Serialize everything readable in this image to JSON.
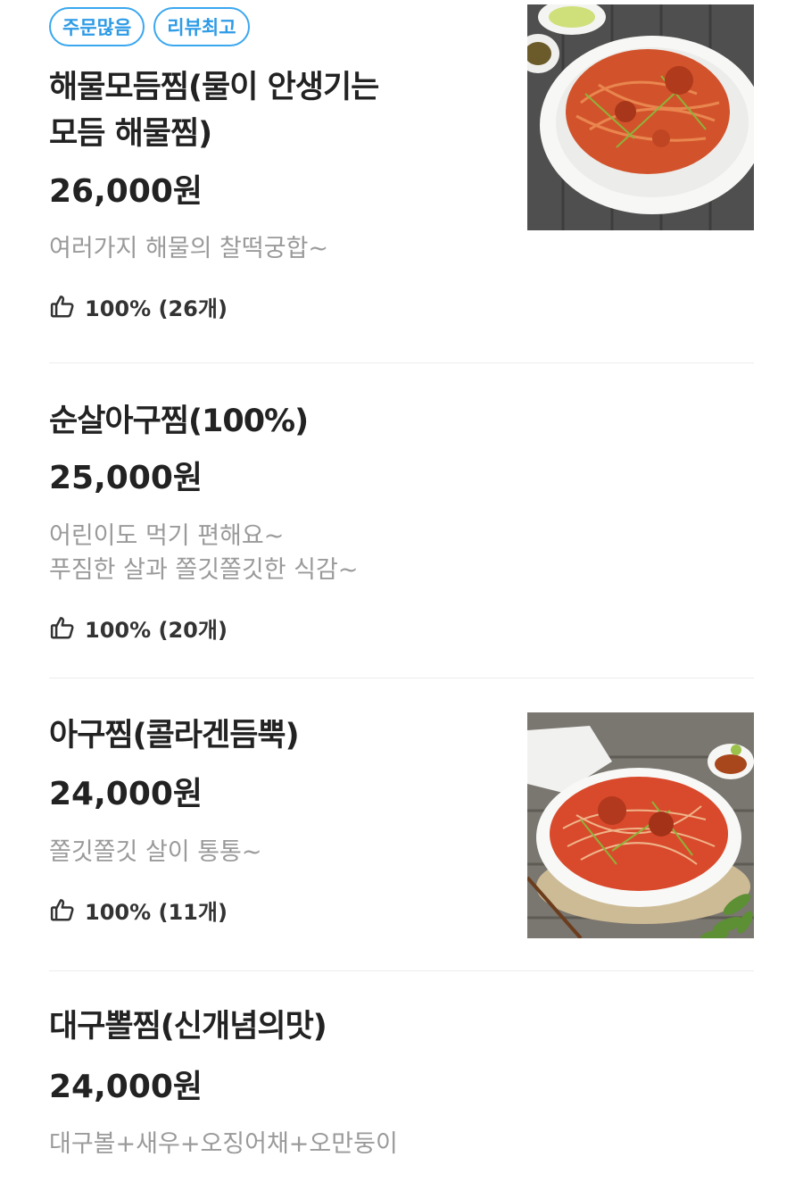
{
  "menu": {
    "items": [
      {
        "tags": [
          "주문많음",
          "리뷰최고"
        ],
        "name_line1": "해물모듬찜(물이 안생기는",
        "name_line2": "모듬 해물찜)",
        "price": "26,000원",
        "desc_line1": "여러가지 해물의 찰떡궁합~",
        "rating_text": "100% (26개)"
      },
      {
        "name_line1": "순살아구찜(100%)",
        "price": "25,000원",
        "desc_line1": "어린이도 먹기 편해요~",
        "desc_line2": "푸짐한 살과 쫄깃쫄깃한 식감~",
        "rating_text": "100% (20개)"
      },
      {
        "name_line1": "아구찜(콜라겐듬뿍)",
        "price": "24,000원",
        "desc_line1": "쫄깃쫄깃 살이 통통~",
        "rating_text": "100% (11개)"
      },
      {
        "name_line1": "대구뽈찜(신개념의맛)",
        "price": "24,000원",
        "desc_line1": "대구볼+새우+오징어채+오만둥이"
      }
    ]
  },
  "icons": {
    "rating": "thumbs-up-icon"
  },
  "colors": {
    "tag_border": "#3aa7ef",
    "tag_text": "#2e9be6",
    "price": "#222222",
    "description": "#9a9a9a",
    "divider": "#ececec"
  }
}
